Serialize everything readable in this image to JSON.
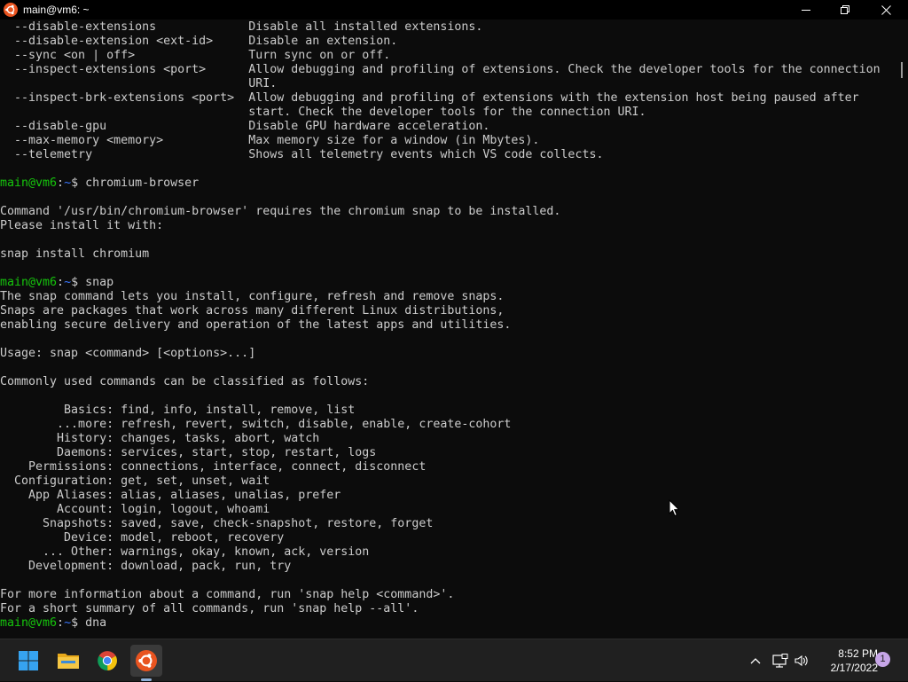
{
  "window": {
    "title": "main@vm6: ~",
    "app_icon": "ubuntu-icon"
  },
  "terminal": {
    "prompt_user": "main@vm6",
    "prompt_sep": ":",
    "prompt_path": "~",
    "prompt_end": "$ ",
    "lines": [
      {
        "type": "text",
        "text": "  --disable-extensions             Disable all installed extensions."
      },
      {
        "type": "text",
        "text": "  --disable-extension <ext-id>     Disable an extension."
      },
      {
        "type": "text",
        "text": "  --sync <on | off>                Turn sync on or off."
      },
      {
        "type": "text",
        "text": "  --inspect-extensions <port>      Allow debugging and profiling of extensions. Check the developer tools for the connection"
      },
      {
        "type": "text",
        "text": "                                   URI."
      },
      {
        "type": "text",
        "text": "  --inspect-brk-extensions <port>  Allow debugging and profiling of extensions with the extension host being paused after"
      },
      {
        "type": "text",
        "text": "                                   start. Check the developer tools for the connection URI."
      },
      {
        "type": "text",
        "text": "  --disable-gpu                    Disable GPU hardware acceleration."
      },
      {
        "type": "text",
        "text": "  --max-memory <memory>            Max memory size for a window (in Mbytes)."
      },
      {
        "type": "text",
        "text": "  --telemetry                      Shows all telemetry events which VS code collects."
      },
      {
        "type": "text",
        "text": ""
      },
      {
        "type": "prompt",
        "text": "chromium-browser"
      },
      {
        "type": "text",
        "text": ""
      },
      {
        "type": "text",
        "text": "Command '/usr/bin/chromium-browser' requires the chromium snap to be installed."
      },
      {
        "type": "text",
        "text": "Please install it with:"
      },
      {
        "type": "text",
        "text": ""
      },
      {
        "type": "text",
        "text": "snap install chromium"
      },
      {
        "type": "text",
        "text": ""
      },
      {
        "type": "prompt",
        "text": "snap"
      },
      {
        "type": "text",
        "text": "The snap command lets you install, configure, refresh and remove snaps."
      },
      {
        "type": "text",
        "text": "Snaps are packages that work across many different Linux distributions,"
      },
      {
        "type": "text",
        "text": "enabling secure delivery and operation of the latest apps and utilities."
      },
      {
        "type": "text",
        "text": ""
      },
      {
        "type": "text",
        "text": "Usage: snap <command> [<options>...]"
      },
      {
        "type": "text",
        "text": ""
      },
      {
        "type": "text",
        "text": "Commonly used commands can be classified as follows:"
      },
      {
        "type": "text",
        "text": ""
      },
      {
        "type": "text",
        "text": "         Basics: find, info, install, remove, list"
      },
      {
        "type": "text",
        "text": "        ...more: refresh, revert, switch, disable, enable, create-cohort"
      },
      {
        "type": "text",
        "text": "        History: changes, tasks, abort, watch"
      },
      {
        "type": "text",
        "text": "        Daemons: services, start, stop, restart, logs"
      },
      {
        "type": "text",
        "text": "    Permissions: connections, interface, connect, disconnect"
      },
      {
        "type": "text",
        "text": "  Configuration: get, set, unset, wait"
      },
      {
        "type": "text",
        "text": "    App Aliases: alias, aliases, unalias, prefer"
      },
      {
        "type": "text",
        "text": "        Account: login, logout, whoami"
      },
      {
        "type": "text",
        "text": "      Snapshots: saved, save, check-snapshot, restore, forget"
      },
      {
        "type": "text",
        "text": "         Device: model, reboot, recovery"
      },
      {
        "type": "text",
        "text": "      ... Other: warnings, okay, known, ack, version"
      },
      {
        "type": "text",
        "text": "    Development: download, pack, run, try"
      },
      {
        "type": "text",
        "text": ""
      },
      {
        "type": "text",
        "text": "For more information about a command, run 'snap help <command>'."
      },
      {
        "type": "text",
        "text": "For a short summary of all commands, run 'snap help --all'."
      },
      {
        "type": "prompt",
        "text": "dna"
      }
    ]
  },
  "taskbar": {
    "apps": [
      {
        "name": "start-button",
        "icon": "windows-logo-icon"
      },
      {
        "name": "file-explorer",
        "icon": "folder-icon"
      },
      {
        "name": "chrome",
        "icon": "chrome-icon"
      },
      {
        "name": "ubuntu-terminal",
        "icon": "ubuntu-icon",
        "active": true
      }
    ],
    "tray_icons": [
      "chevron-up-icon",
      "network-icon",
      "volume-icon"
    ],
    "time": "8:52 PM",
    "date": "2/17/2022",
    "notification_count": "1"
  },
  "colors": {
    "terminal_bg": "#0c0c0c",
    "terminal_fg": "#cccccc",
    "prompt_user": "#16c60c",
    "prompt_path": "#3b78ff",
    "ubuntu_orange": "#e95420",
    "taskbar_bg": "#202020"
  }
}
